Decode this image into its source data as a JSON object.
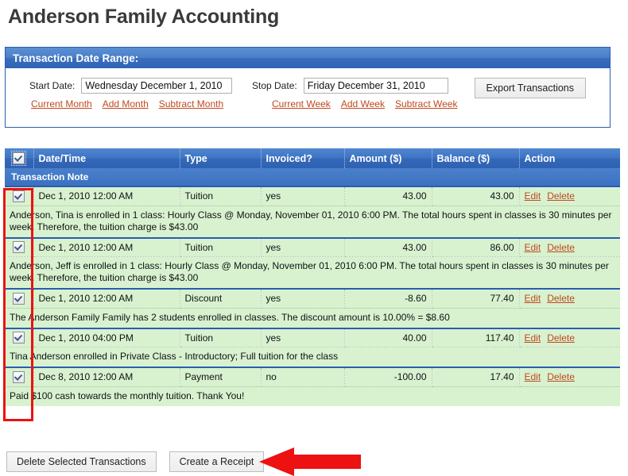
{
  "page": {
    "title": "Anderson Family Accounting"
  },
  "date_panel": {
    "header": "Transaction Date Range:",
    "start_label": "Start Date:",
    "start_value": "Wednesday December 1, 2010",
    "start_placeholder": "Start date",
    "stop_label": "Stop Date:",
    "stop_value": "Friday December 31, 2010",
    "stop_placeholder": "Stop date",
    "start_links": [
      "Current Month",
      "Add Month",
      "Subtract Month"
    ],
    "stop_links": [
      "Current Week",
      "Add Week",
      "Subtract Week"
    ],
    "export_button": "Export Transactions"
  },
  "table": {
    "headers": {
      "select_all": "select-all-checkbox",
      "datetime": "Date/Time",
      "type": "Type",
      "invoiced": "Invoiced?",
      "amount": "Amount ($)",
      "balance": "Balance ($)",
      "action": "Action"
    },
    "note_header": "Transaction Note",
    "action_labels": {
      "edit": "Edit",
      "delete": "Delete"
    },
    "rows": [
      {
        "checked": true,
        "datetime": "Dec 1, 2010 12:00 AM",
        "type": "Tuition",
        "invoiced": "yes",
        "amount": "43.00",
        "balance": "43.00",
        "note": "Anderson, Tina is enrolled in 1 class: Hourly Class @ Monday, November 01, 2010 6:00 PM. The total hours spent in classes is 30 minutes per week. Therefore, the tuition charge is $43.00"
      },
      {
        "checked": true,
        "datetime": "Dec 1, 2010 12:00 AM",
        "type": "Tuition",
        "invoiced": "yes",
        "amount": "43.00",
        "balance": "86.00",
        "note": "Anderson, Jeff is enrolled in 1 class: Hourly Class @ Monday, November 01, 2010 6:00 PM. The total hours spent in classes is 30 minutes per week. Therefore, the tuition charge is $43.00"
      },
      {
        "checked": true,
        "datetime": "Dec 1, 2010 12:00 AM",
        "type": "Discount",
        "invoiced": "yes",
        "amount": "-8.60",
        "balance": "77.40",
        "note": "The Anderson Family Family has 2 students enrolled in classes. The discount amount is 10.00% = $8.60"
      },
      {
        "checked": true,
        "datetime": "Dec 1, 2010 04:00 PM",
        "type": "Tuition",
        "invoiced": "yes",
        "amount": "40.00",
        "balance": "117.40",
        "note": "Tina Anderson enrolled in Private Class - Introductory; Full tuition for the class"
      },
      {
        "checked": true,
        "datetime": "Dec 8, 2010 12:00 AM",
        "type": "Payment",
        "invoiced": "no",
        "amount": "-100.00",
        "balance": "17.40",
        "note": "Paid $100 cash towards the monthly tuition. Thank You!"
      }
    ]
  },
  "bottom": {
    "delete_button": "Delete Selected Transactions",
    "receipt_button": "Create a Receipt"
  },
  "annotations": {
    "highlight_color": "#ee1111",
    "arrow_color": "#ee1111",
    "arrow_points_to": "create-a-receipt-button"
  }
}
